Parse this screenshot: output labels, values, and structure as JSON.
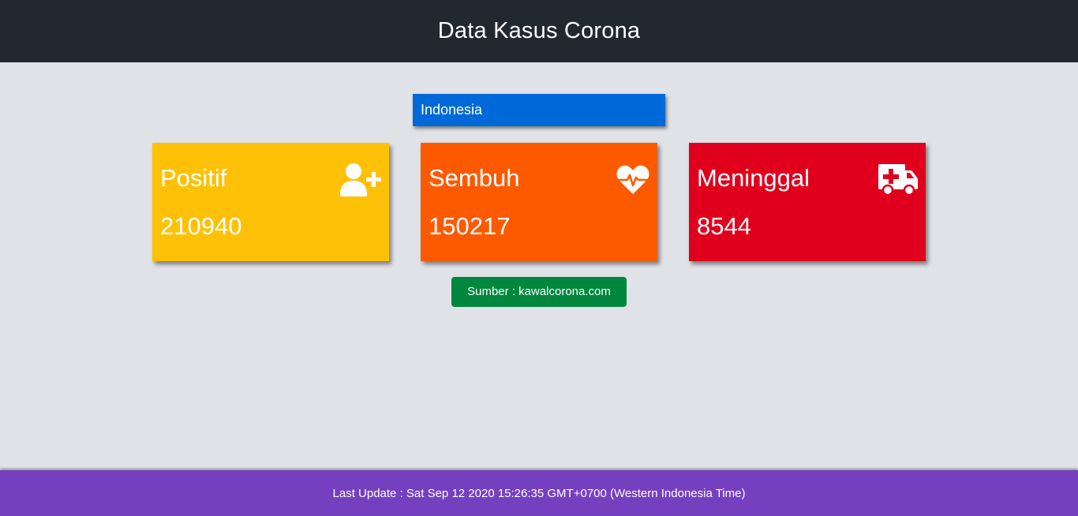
{
  "header": {
    "title": "Data Kasus Corona"
  },
  "country": {
    "label": "Indonesia"
  },
  "cards": [
    {
      "label": "Positif",
      "value": "210940",
      "icon": "user-plus-icon",
      "color": "#ffc107"
    },
    {
      "label": "Sembuh",
      "value": "150217",
      "icon": "heartbeat-icon",
      "color": "#fd5a00"
    },
    {
      "label": "Meninggal",
      "value": "8544",
      "icon": "ambulance-icon",
      "color": "#e0001e"
    }
  ],
  "source": {
    "label": "Sumber : kawalcorona.com",
    "color": "#00873d"
  },
  "footer": {
    "last_update": "Last Update : Sat Sep 12 2020 15:26:35 GMT+0700 (Western Indonesia Time)",
    "color": "#7540c0"
  },
  "colors": {
    "header_bg": "#212830",
    "page_bg": "#dfe2e7",
    "country_bg": "#0069d9"
  }
}
